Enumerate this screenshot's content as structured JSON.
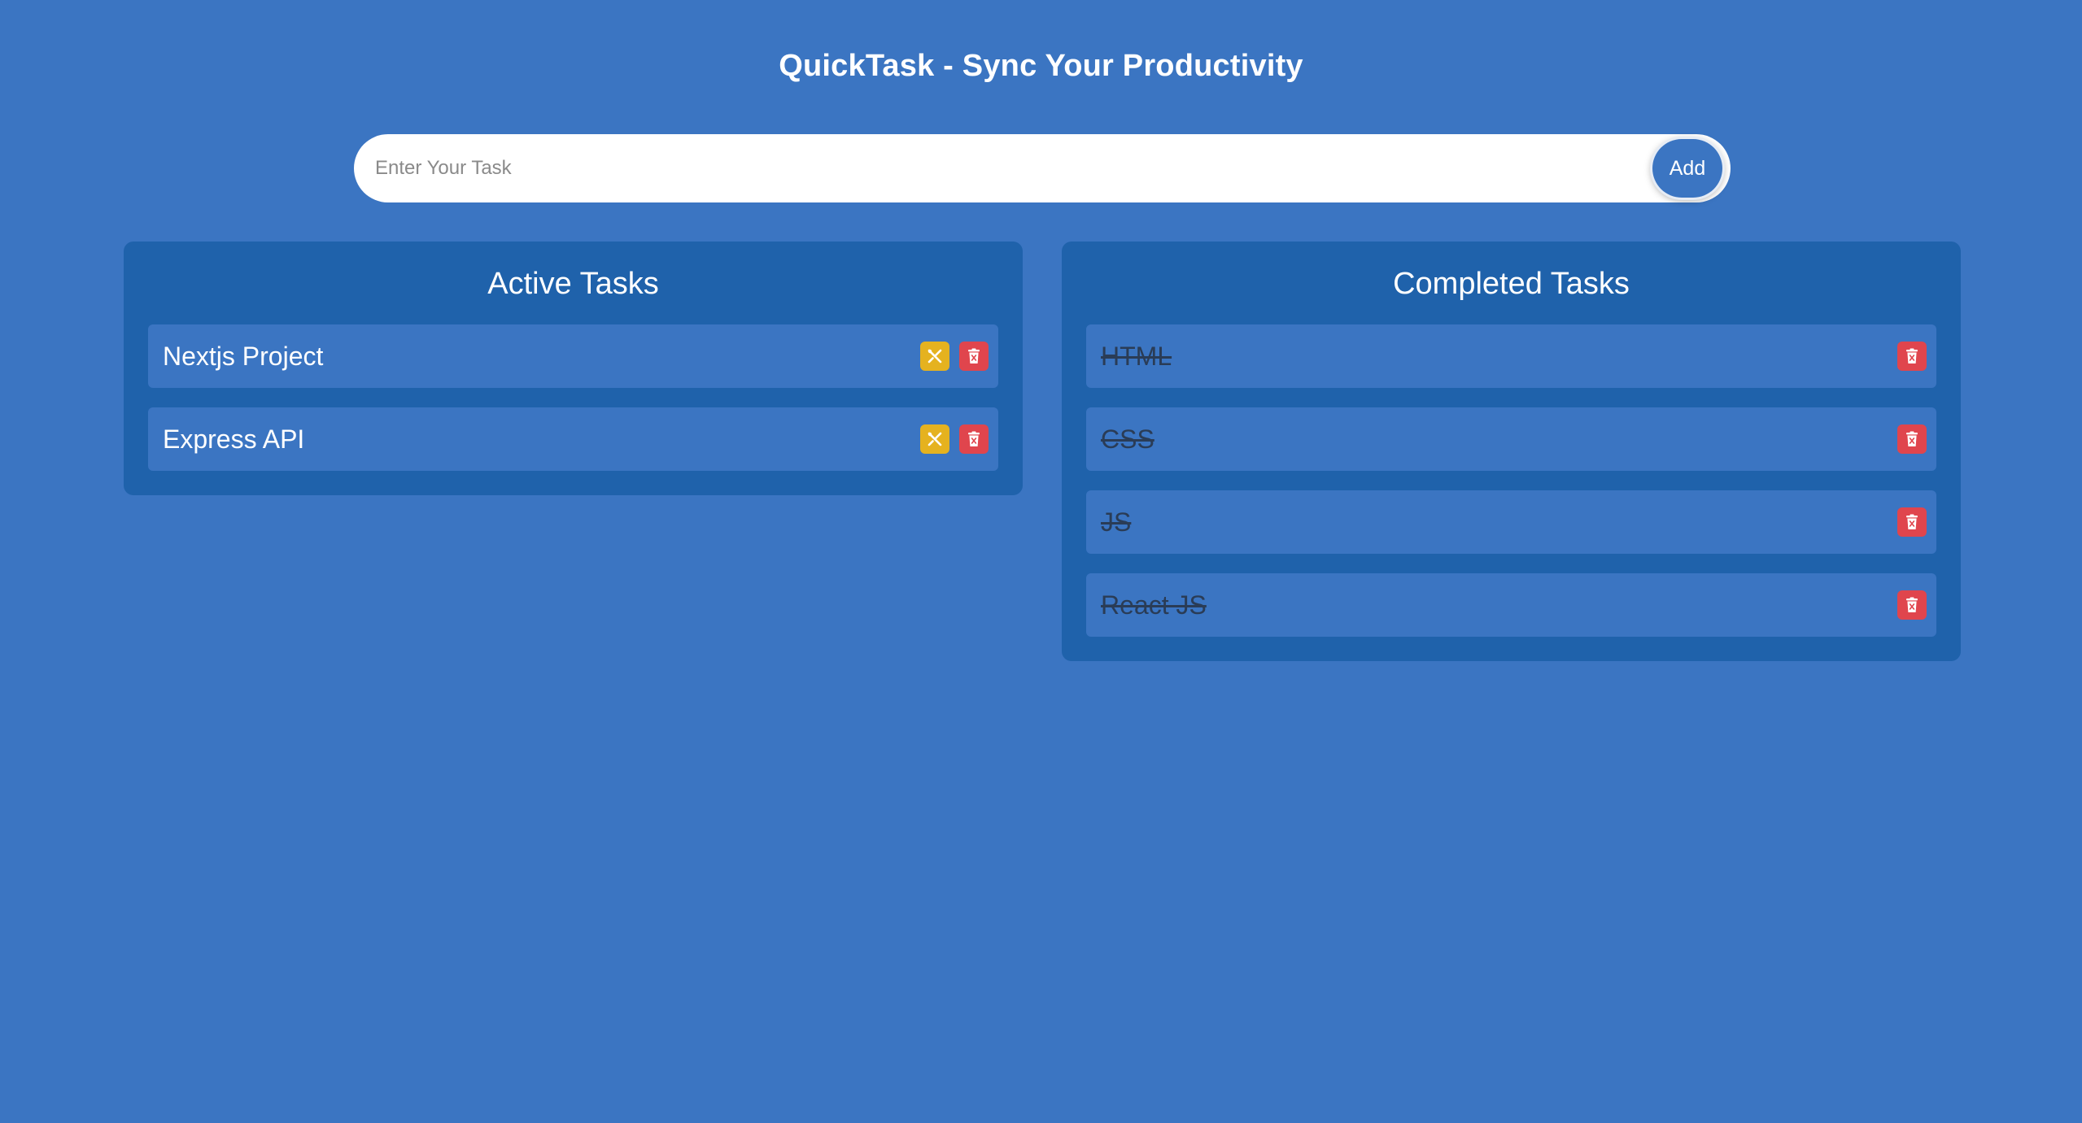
{
  "header": {
    "title": "QuickTask - Sync Your Productivity"
  },
  "form": {
    "placeholder": "Enter Your Task",
    "value": "",
    "add_label": "Add"
  },
  "active": {
    "title": "Active Tasks",
    "tasks": [
      {
        "text": "Nextjs Project"
      },
      {
        "text": "Express API"
      }
    ]
  },
  "completed": {
    "title": "Completed Tasks",
    "tasks": [
      {
        "text": "HTML"
      },
      {
        "text": "CSS"
      },
      {
        "text": "JS"
      },
      {
        "text": "React JS"
      }
    ]
  },
  "icons": {
    "complete": "wrench-screwdriver-icon",
    "delete": "trash-icon"
  },
  "colors": {
    "background": "#3b75c2",
    "panel": "#1f62ab",
    "complete_button": "#e5b21f",
    "delete_button": "#e0454d",
    "completed_text": "#2a3c56"
  }
}
